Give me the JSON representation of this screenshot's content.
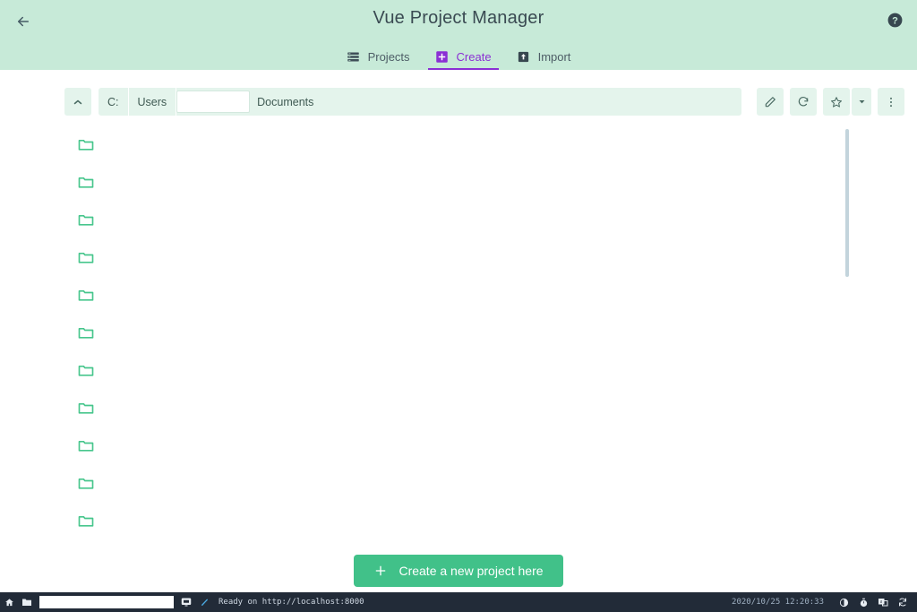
{
  "header": {
    "title": "Vue Project Manager",
    "back_icon": "arrow-left-icon",
    "help_icon": "help-circle-icon",
    "background_color": "#c7ead8",
    "accent_color": "#8b2fd4"
  },
  "tabs": [
    {
      "label": "Projects",
      "icon": "list-icon",
      "active": false
    },
    {
      "label": "Create",
      "icon": "plus-square-icon",
      "active": true
    },
    {
      "label": "Import",
      "icon": "import-box-icon",
      "active": false
    }
  ],
  "toolbar": {
    "up_icon": "chevron-up-icon",
    "path": {
      "crumbs": [
        "C:",
        "Users"
      ],
      "input_value": "",
      "input_placeholder": "",
      "tail": "Documents"
    },
    "actions": [
      {
        "name": "edit-path-button",
        "icon": "pencil-icon"
      },
      {
        "name": "refresh-button",
        "icon": "refresh-icon"
      },
      {
        "name": "bookmark-button",
        "icon": "star-icon"
      },
      {
        "name": "bookmark-dropdown-button",
        "icon": "caret-down-icon"
      },
      {
        "name": "more-options-button",
        "icon": "dots-vertical-icon"
      }
    ]
  },
  "filelist": {
    "icon": "folder-icon",
    "rows": [
      {
        "name": ""
      },
      {
        "name": ""
      },
      {
        "name": ""
      },
      {
        "name": ""
      },
      {
        "name": ""
      },
      {
        "name": ""
      },
      {
        "name": ""
      },
      {
        "name": ""
      },
      {
        "name": ""
      },
      {
        "name": ""
      },
      {
        "name": ""
      }
    ]
  },
  "cta": {
    "label": "Create a new project here",
    "icon": "plus-icon",
    "color": "#41c189"
  },
  "taskbar": {
    "home_icon": "home-icon",
    "folder_icon": "folder-icon",
    "input_value": "",
    "monitor_icon": "monitor-icon",
    "pencil_icon": "pencil-icon",
    "status": "Ready on http://localhost:8000",
    "clock": "2020/10/25 12:20:33",
    "tray": [
      {
        "name": "brightness-icon"
      },
      {
        "name": "timer-icon"
      },
      {
        "name": "keyboard-layout-icon"
      },
      {
        "name": "sync-icon"
      }
    ]
  }
}
